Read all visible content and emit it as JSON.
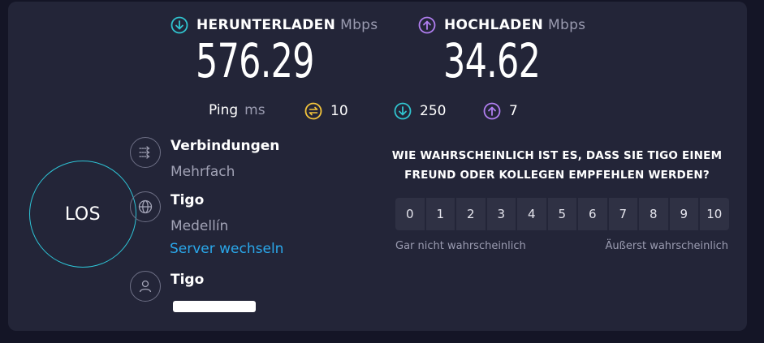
{
  "download": {
    "label": "HERUNTERLADEN",
    "unit": "Mbps",
    "value": "576.29",
    "icon": "download-arrow-icon",
    "color": "#30c4cf"
  },
  "upload": {
    "label": "HOCHLADEN",
    "unit": "Mbps",
    "value": "34.62",
    "icon": "upload-arrow-icon",
    "color": "#b07ef0"
  },
  "ping": {
    "label": "Ping",
    "unit": "ms",
    "idle": "10",
    "download_latency": "250",
    "upload_latency": "7",
    "idle_color": "#f3c43b"
  },
  "go_button": {
    "label": "LOS",
    "ring_color": "#2ec4d6"
  },
  "connections": {
    "title": "Verbindungen",
    "value": "Mehrfach",
    "icon": "connections-icon"
  },
  "server": {
    "title": "Tigo",
    "location": "Medellín",
    "change_link": "Server wechseln",
    "icon": "globe-icon"
  },
  "provider": {
    "title": "Tigo",
    "icon": "user-icon"
  },
  "survey": {
    "question": "WIE WAHRSCHEINLICH IST ES, DASS SIE TIGO EINEM FREUND ODER KOLLEGEN EMPFEHLEN WERDEN?",
    "scale": [
      "0",
      "1",
      "2",
      "3",
      "4",
      "5",
      "6",
      "7",
      "8",
      "9",
      "10"
    ],
    "low_label": "Gar nicht wahrscheinlich",
    "high_label": "Äußerst wahrscheinlich"
  }
}
